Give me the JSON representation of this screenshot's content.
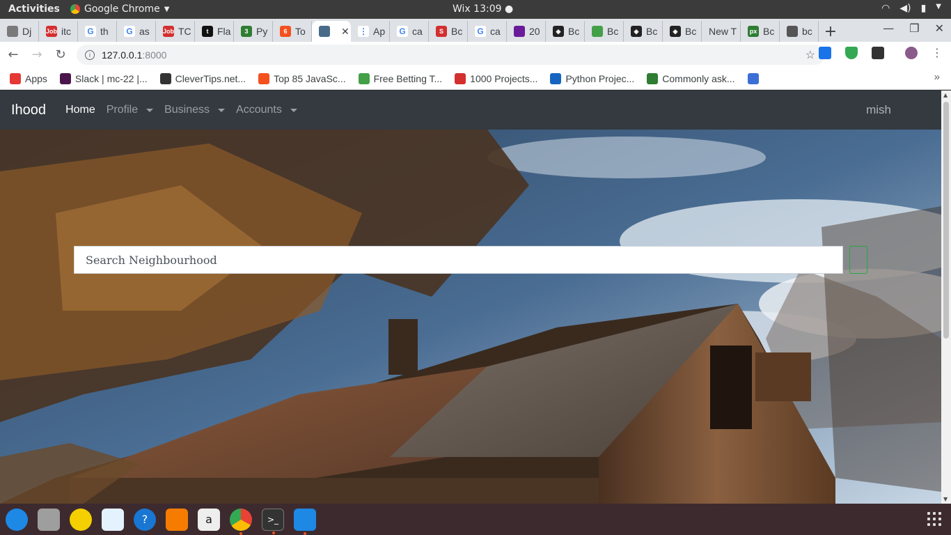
{
  "system": {
    "activities": "Activities",
    "app_name": "Google Chrome",
    "clock": "Wix 13:09 ●"
  },
  "tabs": [
    {
      "label": "Dj",
      "color": "#7a7a7a",
      "glyph": ""
    },
    {
      "label": "itc",
      "color": "#d32f2f",
      "glyph": "Job"
    },
    {
      "label": "th",
      "color": "#ffffff",
      "glyph": "G"
    },
    {
      "label": "as",
      "color": "#ffffff",
      "glyph": "G"
    },
    {
      "label": "TC",
      "color": "#d32f2f",
      "glyph": "Job"
    },
    {
      "label": "Fla",
      "color": "#111111",
      "glyph": "t"
    },
    {
      "label": "Py",
      "color": "#2e7d32",
      "glyph": "3"
    },
    {
      "label": "To",
      "color": "#f4511e",
      "glyph": "6"
    },
    {
      "label": "",
      "color": "#4a6a8a",
      "glyph": ""
    },
    {
      "label": "Ap",
      "color": "#ffffff",
      "glyph": "⋮"
    },
    {
      "label": "ca",
      "color": "#ffffff",
      "glyph": "G"
    },
    {
      "label": "Bc",
      "color": "#d32f2f",
      "glyph": "S"
    },
    {
      "label": "ca",
      "color": "#ffffff",
      "glyph": "G"
    },
    {
      "label": "20",
      "color": "#6a1b9a",
      "glyph": ""
    },
    {
      "label": "Bc",
      "color": "#222222",
      "glyph": "◈"
    },
    {
      "label": "Bc",
      "color": "#43a047",
      "glyph": ""
    },
    {
      "label": "Bc",
      "color": "#222222",
      "glyph": "◈"
    },
    {
      "label": "Bc",
      "color": "#222222",
      "glyph": "◈"
    },
    {
      "label": "New T",
      "color": "",
      "glyph": ""
    },
    {
      "label": "Bc",
      "color": "#2e7d32",
      "glyph": "px"
    },
    {
      "label": "bc",
      "color": "#555555",
      "glyph": ""
    }
  ],
  "address": {
    "host": "127.0.0.1",
    "port": ":8000"
  },
  "bookmarks": [
    {
      "label": "Apps",
      "color": "#e53935"
    },
    {
      "label": "Slack | mc-22 |...",
      "color": "#4a154b"
    },
    {
      "label": "CleverTips.net...",
      "color": "#333333"
    },
    {
      "label": "Top 85 JavaSc...",
      "color": "#f4511e"
    },
    {
      "label": "Free Betting T...",
      "color": "#43a047"
    },
    {
      "label": "1000 Projects...",
      "color": "#d32f2f"
    },
    {
      "label": "Python Projec...",
      "color": "#1565c0"
    },
    {
      "label": "Commonly ask...",
      "color": "#2e7d32"
    }
  ],
  "site": {
    "brand": "Ihood",
    "nav": [
      {
        "label": "Home",
        "active": true,
        "dropdown": false
      },
      {
        "label": "Profile",
        "active": false,
        "dropdown": true
      },
      {
        "label": "Business",
        "active": false,
        "dropdown": true
      },
      {
        "label": "Accounts",
        "active": false,
        "dropdown": true
      }
    ],
    "user": "mish",
    "search_placeholder": "Search Neighbourhood"
  },
  "colors": {
    "navbar": "#343a40",
    "search_button_border": "#28a745",
    "dock": "#3d2a2f"
  }
}
